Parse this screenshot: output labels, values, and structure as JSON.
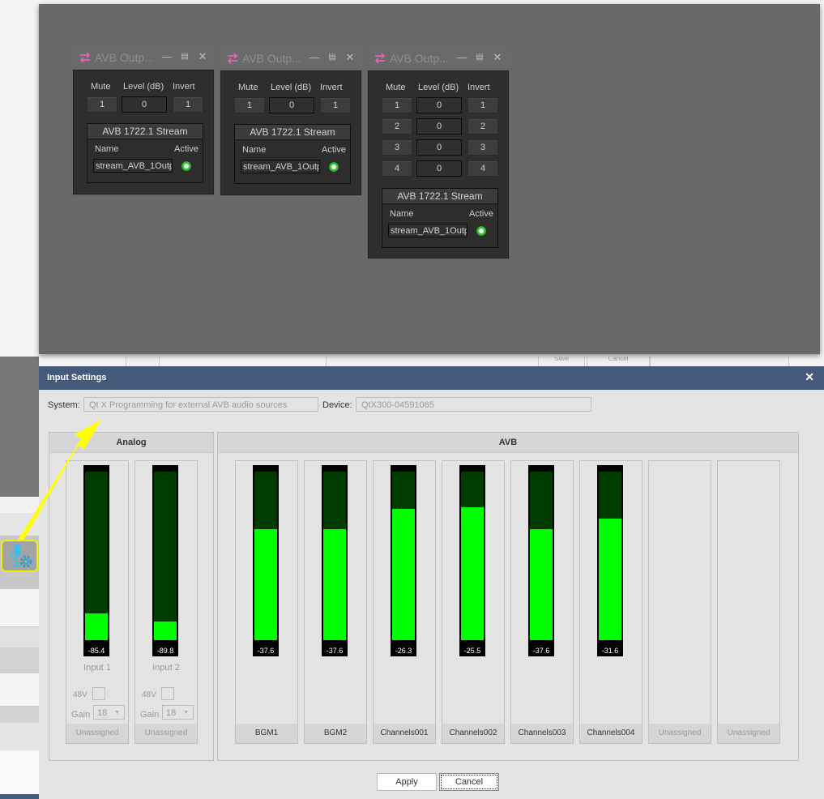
{
  "avb_windows": [
    {
      "title": "AVB Outp...",
      "headers": {
        "mute": "Mute",
        "level": "Level (dB)",
        "invert": "Invert"
      },
      "channels": [
        {
          "mute": "1",
          "level": "0",
          "invert": "1"
        }
      ],
      "stream": {
        "title": "AVB 1722.1 Stream",
        "name_label": "Name",
        "active_label": "Active",
        "name_value": "stream_AVB_1Outp",
        "active": true
      }
    },
    {
      "title": "AVB Outp...",
      "headers": {
        "mute": "Mute",
        "level": "Level (dB)",
        "invert": "Invert"
      },
      "channels": [
        {
          "mute": "1",
          "level": "0",
          "invert": "1"
        }
      ],
      "stream": {
        "title": "AVB 1722.1 Stream",
        "name_label": "Name",
        "active_label": "Active",
        "name_value": "stream_AVB_1Outp",
        "active": true
      }
    },
    {
      "title": "AVB Outp...",
      "headers": {
        "mute": "Mute",
        "level": "Level (dB)",
        "invert": "Invert"
      },
      "channels": [
        {
          "mute": "1",
          "level": "0",
          "invert": "1"
        },
        {
          "mute": "2",
          "level": "0",
          "invert": "2"
        },
        {
          "mute": "3",
          "level": "0",
          "invert": "3"
        },
        {
          "mute": "4",
          "level": "0",
          "invert": "4"
        }
      ],
      "stream": {
        "title": "AVB 1722.1 Stream",
        "name_label": "Name",
        "active_label": "Active",
        "name_value": "stream_AVB_1Outp",
        "active": true
      }
    }
  ],
  "dialog": {
    "title": "Input Settings",
    "close_icon": "close-icon",
    "system_label": "System:",
    "system_value": "Qt X Programming for external AVB audio sources",
    "device_label": "Device:",
    "device_value": "QtX300-04591065",
    "analog": {
      "title": "Analog",
      "channels": [
        {
          "level_text": "-85.4",
          "level_fraction": 0.16,
          "name": "Input 1",
          "phantom_label": "48V",
          "phantom_checked": false,
          "gain_label": "Gain",
          "gain_value": "18",
          "assignment": "Unassigned"
        },
        {
          "level_text": "-89.8",
          "level_fraction": 0.11,
          "name": "Input 2",
          "phantom_label": "48V",
          "phantom_checked": false,
          "gain_label": "Gain",
          "gain_value": "18",
          "assignment": "Unassigned"
        }
      ]
    },
    "avb": {
      "title": "AVB",
      "channels": [
        {
          "level_text": "-37.6",
          "level_fraction": 0.66,
          "assignment": "BGM1",
          "assigned": true
        },
        {
          "level_text": "-37.6",
          "level_fraction": 0.66,
          "assignment": "BGM2",
          "assigned": true
        },
        {
          "level_text": "-26.3",
          "level_fraction": 0.78,
          "assignment": "Channels001",
          "assigned": true
        },
        {
          "level_text": "-25.5",
          "level_fraction": 0.79,
          "assignment": "Channels002",
          "assigned": true
        },
        {
          "level_text": "-37.6",
          "level_fraction": 0.66,
          "assignment": "Channels003",
          "assigned": true
        },
        {
          "level_text": "-31.6",
          "level_fraction": 0.72,
          "assignment": "Channels004",
          "assigned": true
        },
        {
          "level_text": null,
          "level_fraction": null,
          "assignment": "Unassigned",
          "assigned": false
        },
        {
          "level_text": null,
          "level_fraction": null,
          "assignment": "Unassigned",
          "assigned": false
        }
      ]
    },
    "buttons": {
      "apply": "Apply",
      "cancel": "Cancel"
    }
  },
  "background": {
    "partial_buttons": [
      "Save",
      "Cancel"
    ]
  },
  "callout": {
    "icon": "microphone-settings-icon",
    "arrow_color": "#ffff00",
    "highlight_color": "#f3f000"
  },
  "colors": {
    "meter_fill": "#00ff00",
    "meter_track": "#003c00",
    "dialog_title_bar": "#455a7a",
    "led_active": "#35c335",
    "route_icon": "#e065b0"
  }
}
